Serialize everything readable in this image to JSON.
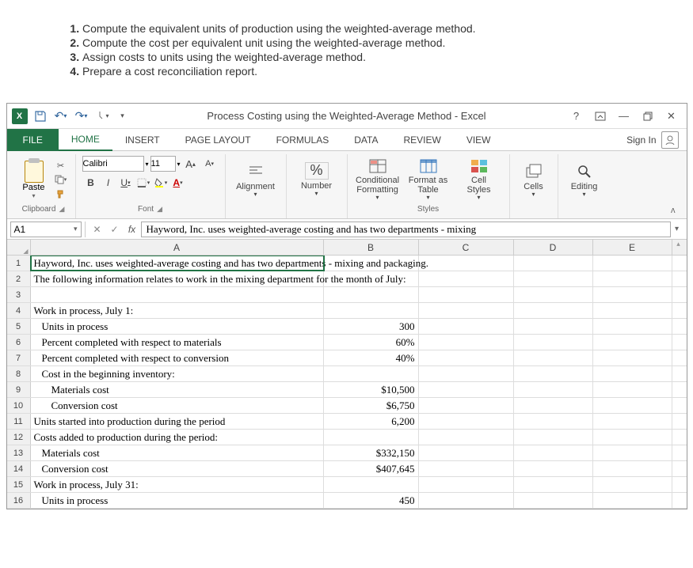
{
  "instructions": [
    "Compute the equivalent units of production using the weighted-average method.",
    "Compute the cost per equivalent unit using the weighted-average method.",
    "Assign costs to units using the weighted-average method.",
    "Prepare a cost reconciliation report."
  ],
  "window": {
    "title": "Process Costing using the Weighted-Average Method - Excel",
    "help": "?",
    "signin": "Sign In"
  },
  "ribbon": {
    "file": "FILE",
    "tabs": [
      "HOME",
      "INSERT",
      "PAGE LAYOUT",
      "FORMULAS",
      "DATA",
      "REVIEW",
      "VIEW"
    ],
    "active_tab": "HOME",
    "clipboard": {
      "label": "Clipboard",
      "paste": "Paste"
    },
    "font": {
      "label": "Font",
      "name": "Calibri",
      "size": "11",
      "bold": "B",
      "italic": "I",
      "underline": "U",
      "grow": "A",
      "shrink": "A"
    },
    "alignment": {
      "label": "Alignment"
    },
    "number": {
      "label": "Number",
      "pct": "%"
    },
    "styles": {
      "label": "Styles",
      "conditional": "Conditional\nFormatting",
      "formatas": "Format as\nTable",
      "cell": "Cell\nStyles"
    },
    "cells": {
      "label": "Cells"
    },
    "editing": {
      "label": "Editing"
    }
  },
  "formula_bar": {
    "name_box": "A1",
    "fx": "fx",
    "content": "Hayword, Inc. uses weighted-average costing and has two departments - mixing"
  },
  "columns": [
    "A",
    "B",
    "C",
    "D",
    "E"
  ],
  "rows": [
    {
      "n": 1,
      "a": "Hayword, Inc. uses weighted-average costing and has two departments - mixing and packaging.",
      "active": true
    },
    {
      "n": 2,
      "a": "The following information relates to work in the mixing department for the month of July:"
    },
    {
      "n": 3,
      "a": ""
    },
    {
      "n": 4,
      "a": "Work in process, July 1:"
    },
    {
      "n": 5,
      "a": "Units in process",
      "indent": 1,
      "b": "300",
      "balign": "num"
    },
    {
      "n": 6,
      "a": "Percent completed with respect to materials",
      "indent": 1,
      "b": "60%",
      "balign": "num"
    },
    {
      "n": 7,
      "a": "Percent completed with respect to conversion",
      "indent": 1,
      "b": "40%",
      "balign": "num"
    },
    {
      "n": 8,
      "a": "Cost in the beginning inventory:",
      "indent": 1
    },
    {
      "n": 9,
      "a": "Materials cost",
      "indent": 2,
      "b": "$10,500",
      "balign": "num"
    },
    {
      "n": 10,
      "a": "Conversion cost",
      "indent": 2,
      "b": "$6,750",
      "balign": "num"
    },
    {
      "n": 11,
      "a": "Units started into production during the period",
      "b": "6,200",
      "balign": "num"
    },
    {
      "n": 12,
      "a": "Costs added to production during the period:"
    },
    {
      "n": 13,
      "a": "Materials cost",
      "indent": 1,
      "b": "$332,150",
      "balign": "num"
    },
    {
      "n": 14,
      "a": "Conversion cost",
      "indent": 1,
      "b": "$407,645",
      "balign": "num"
    },
    {
      "n": 15,
      "a": "Work in process, July 31:"
    },
    {
      "n": 16,
      "a": "Units in process",
      "indent": 1,
      "b": "450",
      "balign": "num"
    }
  ]
}
